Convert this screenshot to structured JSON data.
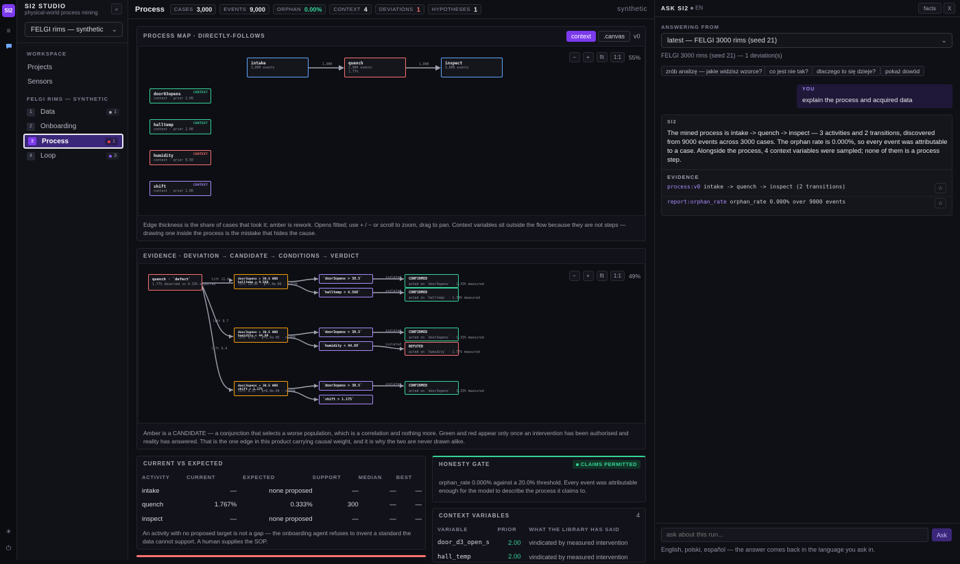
{
  "app": {
    "logo": "SI2",
    "name": "SI2 STUDIO",
    "tagline": "physical-world process mining",
    "collapse_icon": "«"
  },
  "dataset_select": {
    "value": "FELGI rims — synthetic"
  },
  "sidebar": {
    "workspace_heading": "WORKSPACE",
    "workspace_items": [
      {
        "label": "Projects"
      },
      {
        "label": "Sensors"
      }
    ],
    "project_heading": "FELGI RIMS — SYNTHETIC",
    "steps": [
      {
        "num": "1",
        "label": "Data",
        "badge": "1",
        "badge_color": "#9ea1ae"
      },
      {
        "num": "2",
        "label": "Onboarding"
      },
      {
        "num": "3",
        "label": "Process",
        "badge": "1",
        "badge_color": "#ef4444",
        "active": true
      },
      {
        "num": "4",
        "label": "Loop",
        "badge": "3",
        "badge_color": "#8b5cf6"
      }
    ]
  },
  "topbar": {
    "title": "Process",
    "chips": [
      {
        "label": "CASES",
        "value": "3,000"
      },
      {
        "label": "EVENTS",
        "value": "9,000"
      },
      {
        "label": "ORPHAN",
        "value": "0.00%"
      },
      {
        "label": "CONTEXT",
        "value": "4"
      },
      {
        "label": "DEVIATIONS",
        "value": "1"
      },
      {
        "label": "HYPOTHESES",
        "value": "1"
      }
    ],
    "mode": "synthetic"
  },
  "process_map": {
    "heading": "PROCESS MAP · DIRECTLY-FOLLOWS",
    "btn_context": "context",
    "btn_canvas": ".canvas",
    "version": "v0",
    "zoom": {
      "minus": "−",
      "plus": "+",
      "fit": "fit",
      "one": "1:1",
      "level": "55%"
    },
    "nodes": [
      {
        "title": "intake",
        "sub": "3,000 events"
      },
      {
        "title": "quench",
        "sub": "2,900 events\n1.77%"
      },
      {
        "title": "inspect",
        "sub": "3,000 events"
      }
    ],
    "edges": [
      "1,000",
      "1,000"
    ],
    "context_nodes": [
      {
        "title": "door03opens",
        "sub": "context · prior 2.00",
        "tag": "CONTEXT"
      },
      {
        "title": "halltemp",
        "sub": "context · prior 2.00",
        "tag": "CONTEXT"
      },
      {
        "title": "humidity",
        "sub": "context · prior 0.50",
        "tag": "CONTEXT"
      },
      {
        "title": "shift",
        "sub": "context · prior 1.00",
        "tag": "CONTEXT"
      }
    ],
    "caption": "Edge thickness is the share of cases that took it; amber is rework. Opens fitted; use + / − or scroll to zoom, drag to pan. Context variables sit outside the flow because they are not steps — drawing one inside the process is the mistake that hides the cause."
  },
  "evidence": {
    "heading": "EVIDENCE · DEVIATION → CANDIDATE → CONDITIONS → VERDICT",
    "zoom": {
      "minus": "−",
      "plus": "+",
      "fit": "fit",
      "one": "1:1",
      "level": "49%"
    },
    "root": {
      "title": "quench · `defect`",
      "sub": "1.77% observed vs 0.33% expected"
    },
    "candidates": [
      {
        "title": "door3opens > 30.5 AND halltemp > 4.568",
        "sub": "lift 11.00 · p=7.4e-06 · n=530"
      },
      {
        "title": "door3opens > 30.5 AND humidity < 44.69",
        "sub": "lift 9.71 · p=1.5e-05 · n=388"
      },
      {
        "title": "door3opens > 30.5 AND shift > 1.175",
        "sub": "lift 9.37 · p=6.0e-04 · n=504"
      }
    ],
    "conditions": [
      {
        "title": "`door3opens > 30.5`"
      },
      {
        "title": "`halltemp < 4.568`"
      },
      {
        "title": "`door3opens > 30.5`"
      },
      {
        "title": "`humidity < 44.69`"
      },
      {
        "title": "`door3opens > 30.5`"
      },
      {
        "title": "`shift > 1.175`"
      }
    ],
    "verdicts": [
      {
        "title": "CONFIRMED",
        "sub": "acted on `door3opens` · 1.33% measured"
      },
      {
        "title": "CONFIRMED",
        "sub": "acted on `halltemp` · 1.33% measured"
      },
      {
        "title": "CONFIRMED",
        "sub": "acted on `door3opens` · 1.33% measured"
      },
      {
        "title": "REFUTED",
        "sub": "acted on `humidity` · 1.77% measured"
      },
      {
        "title": "CONFIRMED",
        "sub": "acted on `door3opens` · 1.33% measured"
      }
    ],
    "edge_labels": [
      "lift 11.0",
      "lift 9.7",
      "lift 9.4",
      "isolated",
      "isolated",
      "isolated",
      "isolated",
      "isolated",
      "isolated"
    ],
    "caption": "Amber is a CANDIDATE — a conjunction that selects a worse population, which is a correlation and nothing more. Green and red appear only once an intervention has been authorised and reality has answered. That is the one edge in this product carrying causal weight, and it is why the two are never drawn alike."
  },
  "current_vs_expected": {
    "heading": "CURRENT VS EXPECTED",
    "columns": [
      "ACTIVITY",
      "CURRENT",
      "EXPECTED",
      "SUPPORT",
      "MEDIAN",
      "BEST"
    ],
    "rows": [
      [
        "intake",
        "—",
        "none proposed",
        "—",
        "—",
        "—"
      ],
      [
        "quench",
        "1.767%",
        "0.333%",
        "300",
        "—",
        "—"
      ],
      [
        "inspect",
        "—",
        "none proposed",
        "—",
        "—",
        "—"
      ]
    ],
    "note": "An activity with no proposed target is not a gap — the onboarding agent refuses to invent a standard the data cannot support. A human supplies the SOP."
  },
  "honesty_gate": {
    "heading": "HONESTY GATE",
    "status": "CLAIMS PERMITTED",
    "text": "orphan_rate 0.000% against a 20.0% threshold. Every event was attributable enough for the model to describe the process it claims to."
  },
  "context_variables": {
    "heading": "CONTEXT VARIABLES",
    "count": "4",
    "columns": [
      "VARIABLE",
      "PRIOR",
      "WHAT THE LIBRARY HAS SAID"
    ],
    "rows": [
      [
        "door_d3_open_s",
        "2.00",
        "vindicated by measured intervention"
      ],
      [
        "hall_temp",
        "2.00",
        "vindicated by measured intervention"
      ]
    ]
  },
  "ask": {
    "heading": "ASK SI2",
    "lang": "EN",
    "facts_btn": "facts",
    "close": "X",
    "answering_from_label": "ANSWERING FROM",
    "run_select": "latest — FELGI 3000 rims (seed 21)",
    "run_info": "FELGI 3000 rims (seed 21) — 1 deviation(s)",
    "suggestions": [
      "zrób analizę — jakie widzisz wzorce?",
      "co jest nie tak?",
      "dlaczego to się dzieje?",
      "pokaż dowód"
    ],
    "you_label": "YOU",
    "you_text": "explain the process and acquired data",
    "si2_label": "SI2",
    "si2_text": "The mined process is intake -> quench -> inspect — 3 activities and 2 transitions, discovered from 9000 events across 3000 cases. The orphan rate is 0.000%, so every event was attributable to a case. Alongside the process, 4 context variables were sampled; none of them is a process step.",
    "evidence_label": "EVIDENCE",
    "evidence": [
      {
        "key": "process:v0",
        "text": "intake -> quench -> inspect (2 transitions)"
      },
      {
        "key": "report:orphan_rate",
        "text": "orphan_rate 0.000% over 9000 events"
      }
    ],
    "input_placeholder": "ask about this run...",
    "ask_btn": "Ask",
    "footer": "English, polski, español — the answer comes back in the language you ask in."
  }
}
